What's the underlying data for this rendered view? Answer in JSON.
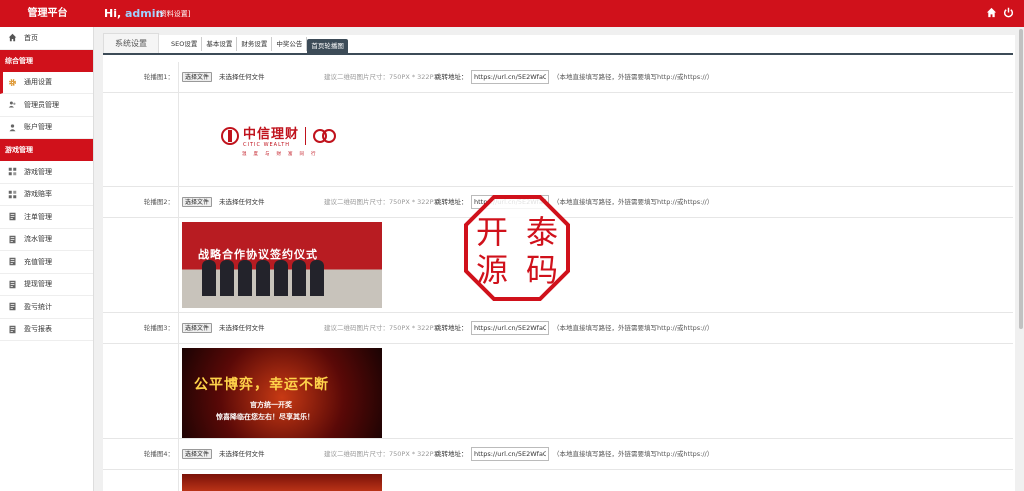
{
  "header": {
    "brand": "管理平台",
    "greeting_prefix": "Hi,",
    "username": "admin",
    "profile_link": "[资料设置]"
  },
  "sidebar": {
    "home": "首页",
    "groups": [
      {
        "title": "综合管理",
        "items": [
          {
            "label": "通用设置",
            "icon": "gear-icon",
            "active": true
          },
          {
            "label": "管理员管理",
            "icon": "users-icon"
          },
          {
            "label": "账户管理",
            "icon": "user-icon"
          }
        ]
      },
      {
        "title": "游戏管理",
        "items": [
          {
            "label": "游戏管理",
            "icon": "grid-icon"
          },
          {
            "label": "游戏赔率",
            "icon": "grid-icon"
          },
          {
            "label": "注单管理",
            "icon": "doc-icon"
          },
          {
            "label": "流水管理",
            "icon": "doc-icon"
          },
          {
            "label": "充值管理",
            "icon": "doc-icon"
          },
          {
            "label": "提现管理",
            "icon": "doc-icon"
          },
          {
            "label": "盈亏统计",
            "icon": "doc-icon"
          },
          {
            "label": "盈亏报表",
            "icon": "doc-icon"
          }
        ]
      }
    ]
  },
  "tabs": {
    "main": "系统设置",
    "items": [
      "SEO设置",
      "基本设置",
      "财务设置",
      "中奖公告",
      "首页轮播图"
    ],
    "active_index": 4
  },
  "carousel": {
    "choose_file": "选择文件",
    "no_file": "未选择任何文件",
    "size_hint": "建议二维码图片尺寸：750PX * 322PX",
    "jump_label": "跳转地址：",
    "note": "（本地直接填写路径，外链需要填写http://或https://）",
    "rows": [
      {
        "label": "轮播图1：",
        "url": "https://url.cn/5E2WfaQ"
      },
      {
        "label": "轮播图2：",
        "url": "https://url.cn/5E2WfaQ"
      },
      {
        "label": "轮播图3：",
        "url": "https://url.cn/5E2WfaQ"
      },
      {
        "label": "轮播图4：",
        "url": "https://url.cn/5E2WfaQ"
      }
    ],
    "banner1": {
      "cn": "中信理财",
      "en": "CITIC WEALTH",
      "sub": "温度与财富同行"
    },
    "banner2": {
      "title": "战略合作协议签约仪式"
    },
    "banner3": {
      "title": "公平博弈，幸运不断",
      "line1": "官方统一开奖",
      "line2": "惊喜降临在您左右！尽享其乐！"
    }
  },
  "watermark": {
    "text": [
      "开",
      "泰",
      "源",
      "码"
    ]
  },
  "colors": {
    "brand_red": "#d0111b",
    "tab_dark": "#3c4b57"
  }
}
